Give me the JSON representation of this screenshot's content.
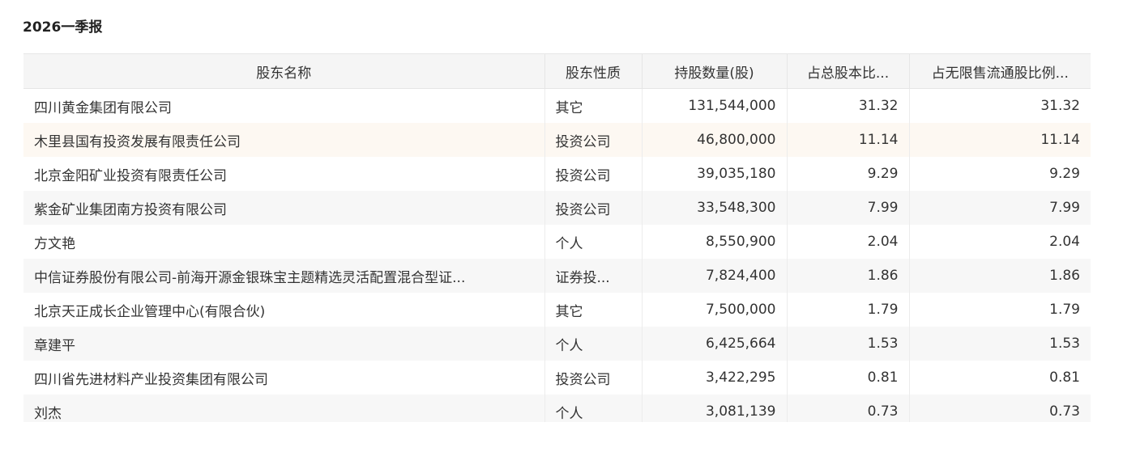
{
  "report": {
    "title": "2026一季报"
  },
  "table": {
    "columns": [
      "股东名称",
      "股东性质",
      "持股数量(股)",
      "占总股本比...",
      "占无限售流通股比例..."
    ],
    "rows": [
      {
        "name": "四川黄金集团有限公司",
        "type": "其它",
        "shares": "131,544,000",
        "total_ratio": "31.32",
        "float_ratio": "31.32"
      },
      {
        "name": "木里县国有投资发展有限责任公司",
        "type": "投资公司",
        "shares": "46,800,000",
        "total_ratio": "11.14",
        "float_ratio": "11.14"
      },
      {
        "name": "北京金阳矿业投资有限责任公司",
        "type": "投资公司",
        "shares": "39,035,180",
        "total_ratio": "9.29",
        "float_ratio": "9.29"
      },
      {
        "name": "紫金矿业集团南方投资有限公司",
        "type": "投资公司",
        "shares": "33,548,300",
        "total_ratio": "7.99",
        "float_ratio": "7.99"
      },
      {
        "name": "方文艳",
        "type": "个人",
        "shares": "8,550,900",
        "total_ratio": "2.04",
        "float_ratio": "2.04"
      },
      {
        "name": "中信证券股份有限公司-前海开源金银珠宝主题精选灵活配置混合型证...",
        "type": "证券投...",
        "shares": "7,824,400",
        "total_ratio": "1.86",
        "float_ratio": "1.86"
      },
      {
        "name": "北京天正成长企业管理中心(有限合伙)",
        "type": "其它",
        "shares": "7,500,000",
        "total_ratio": "1.79",
        "float_ratio": "1.79"
      },
      {
        "name": "章建平",
        "type": "个人",
        "shares": "6,425,664",
        "total_ratio": "1.53",
        "float_ratio": "1.53"
      },
      {
        "name": "四川省先进材料产业投资集团有限公司",
        "type": "投资公司",
        "shares": "3,422,295",
        "total_ratio": "0.81",
        "float_ratio": "0.81"
      },
      {
        "name": "刘杰",
        "type": "个人",
        "shares": "3,081,139",
        "total_ratio": "0.73",
        "float_ratio": "0.73"
      }
    ]
  },
  "colors": {
    "header_bg": "#f5f5f5",
    "stripe_bg": "#f7f7f7",
    "hover_row_bg": "#fdf8f2",
    "text": "#333333"
  }
}
